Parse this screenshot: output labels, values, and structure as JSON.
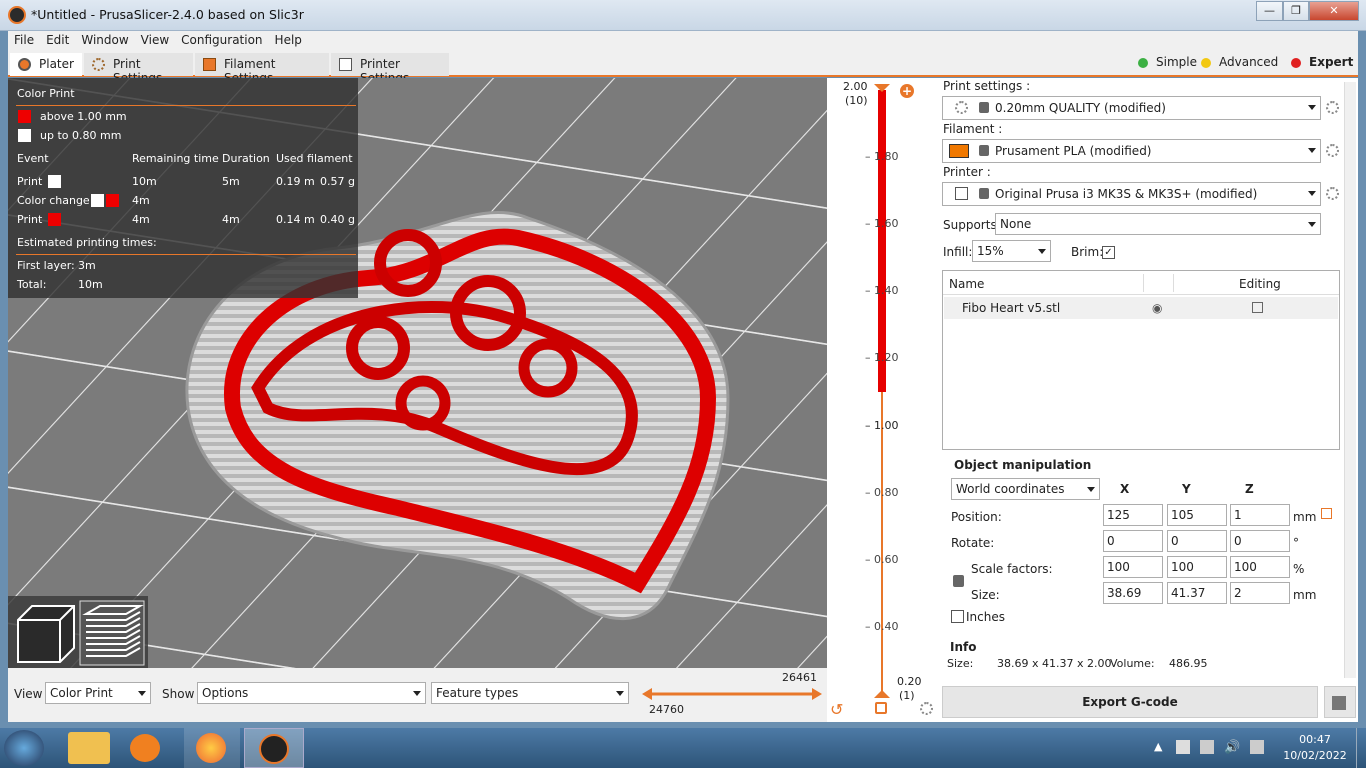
{
  "window": {
    "title": "*Untitled - PrusaSlicer-2.4.0 based on Slic3r"
  },
  "menu": [
    "File",
    "Edit",
    "Window",
    "View",
    "Configuration",
    "Help"
  ],
  "tabs": [
    {
      "label": "Plater",
      "icon": "plater-icon"
    },
    {
      "label": "Print Settings",
      "icon": "gear-icon"
    },
    {
      "label": "Filament Settings",
      "icon": "spool-icon"
    },
    {
      "label": "Printer Settings",
      "icon": "printer-icon"
    }
  ],
  "modes": [
    {
      "label": "Simple",
      "color": "#3cb043"
    },
    {
      "label": "Advanced",
      "color": "#f2c811"
    },
    {
      "label": "Expert",
      "color": "#e02020"
    }
  ],
  "legend": {
    "title": "Color Print",
    "items": [
      {
        "label": "above 1.00 mm",
        "color": "#ee0000"
      },
      {
        "label": "up to 0.80 mm",
        "color": "#ffffff"
      }
    ],
    "headers": [
      "Event",
      "Remaining time",
      "Duration",
      "Used filament"
    ],
    "rows": [
      {
        "event": "Print",
        "remaining": "10m",
        "duration": "5m",
        "length": "0.19 m",
        "weight": "0.57 g"
      },
      {
        "event": "Color change",
        "remaining": "4m",
        "duration": "",
        "length": "",
        "weight": ""
      },
      {
        "event": "Print",
        "remaining": "4m",
        "duration": "4m",
        "length": "0.14 m",
        "weight": "0.40 g"
      }
    ],
    "estimated_label": "Estimated printing times:",
    "first_layer_label": "First layer:",
    "first_layer_value": "3m",
    "total_label": "Total:",
    "total_value": "10m"
  },
  "bottom": {
    "view_label": "View",
    "view_value": "Color Print",
    "show_label": "Show",
    "options_value": "Options",
    "feature_value": "Feature types",
    "h_upper": "26461",
    "h_lower": "24760"
  },
  "vslider": {
    "top_value": "2.00",
    "top_layer": "(10)",
    "bottom_value": "0.20",
    "bottom_layer": "(1)",
    "ticks": [
      "1.80",
      "1.60",
      "1.40",
      "1.20",
      "1.00",
      "0.80",
      "0.60",
      "0.40"
    ],
    "color_change_at": "1.00",
    "fill_fraction_top": 0.5
  },
  "sidebar": {
    "print_settings_label": "Print settings :",
    "print_settings_value": "0.20mm QUALITY (modified)",
    "filament_label": "Filament :",
    "filament_value": "Prusament PLA (modified)",
    "filament_color": "#f07800",
    "printer_label": "Printer :",
    "printer_value": "Original Prusa i3 MK3S & MK3S+ (modified)",
    "supports_label": "Supports:",
    "supports_value": "None",
    "infill_label": "Infill:",
    "infill_value": "15%",
    "brim_label": "Brim:",
    "brim_checked": true,
    "objects_headers": [
      "Name",
      "Editing"
    ],
    "objects": [
      {
        "name": "Fibo Heart v5.stl"
      }
    ]
  },
  "manipulation": {
    "title": "Object manipulation",
    "coords_value": "World coordinates",
    "axes": [
      "X",
      "Y",
      "Z"
    ],
    "position_label": "Position:",
    "position": [
      "125",
      "105",
      "1"
    ],
    "position_unit": "mm",
    "rotate_label": "Rotate:",
    "rotate": [
      "0",
      "0",
      "0"
    ],
    "rotate_unit": "°",
    "scale_label": "Scale factors:",
    "scale": [
      "100",
      "100",
      "100"
    ],
    "scale_unit": "%",
    "size_label": "Size:",
    "size": [
      "38.69",
      "41.37",
      "2"
    ],
    "size_unit": "mm",
    "inches_label": "Inches"
  },
  "info": {
    "title": "Info",
    "size_label": "Size:",
    "size_value": "38.69 x 41.37 x 2.00",
    "volume_label": "Volume:",
    "volume_value": "486.95"
  },
  "export_label": "Export G-code",
  "taskbar": {
    "time": "00:47",
    "date": "10/02/2022"
  }
}
